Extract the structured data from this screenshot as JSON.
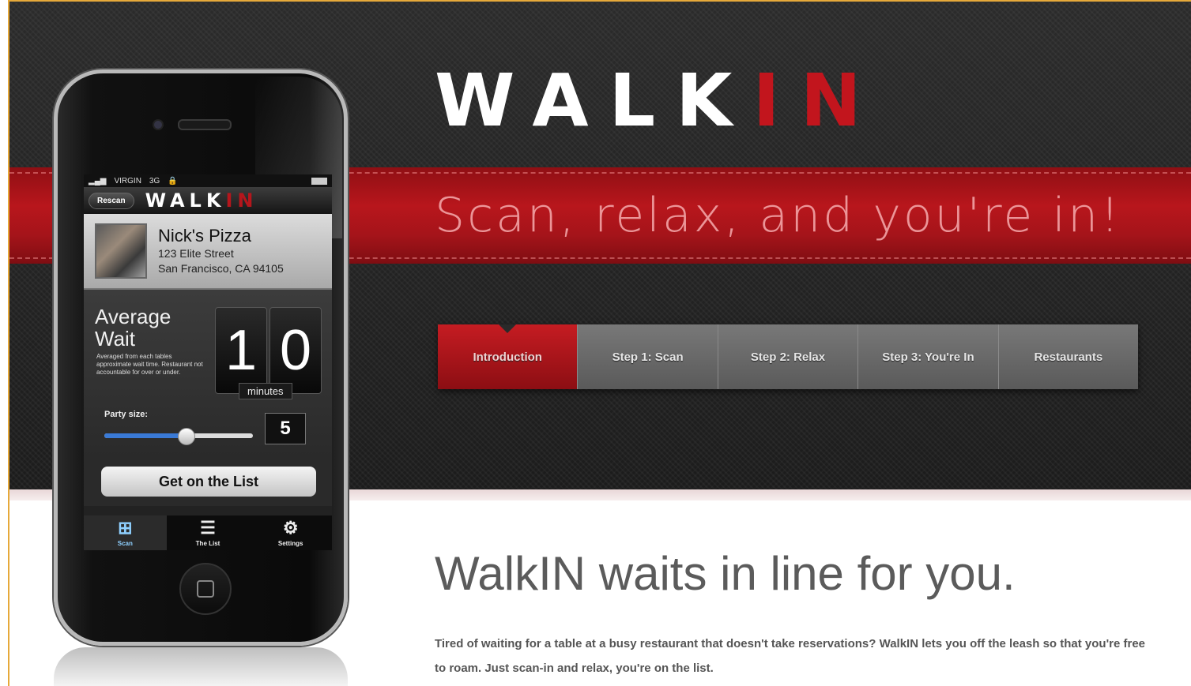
{
  "hero": {
    "logo_main": "WALK",
    "logo_accent": "IN",
    "tagline": "Scan, relax, and you're in!"
  },
  "tabs": [
    {
      "label": "Introduction",
      "active": true
    },
    {
      "label": "Step 1: Scan",
      "active": false
    },
    {
      "label": "Step 2: Relax",
      "active": false
    },
    {
      "label": "Step 3: You're In",
      "active": false
    },
    {
      "label": "Restaurants",
      "active": false
    }
  ],
  "content": {
    "headline": "WalkIN waits in line for you.",
    "description": "Tired of waiting for a table at a busy restaurant that doesn't take reservations? WalkIN lets you off the leash so that you're free to roam. Just scan-in and relax, you're on the list."
  },
  "phone": {
    "status": {
      "carrier": "VIRGIN",
      "network": "3G"
    },
    "navbar": {
      "rescan": "Rescan",
      "logo_main": "WALK",
      "logo_accent": "IN"
    },
    "restaurant": {
      "name": "Nick's Pizza",
      "address1": "123 Elite Street",
      "address2": "San Francisco, CA 94105"
    },
    "wait": {
      "title": "Average Wait",
      "note": "Averaged from each tables approximate wait time. Restaurant not accountable for over or under.",
      "digit1": "1",
      "digit2": "0",
      "unit": "minutes"
    },
    "party": {
      "label": "Party size:",
      "value": "5",
      "slider_fraction": 0.55
    },
    "cta": "Get on the List",
    "tabbar": [
      {
        "label": "Scan",
        "icon": "scan-icon"
      },
      {
        "label": "The List",
        "icon": "list-icon"
      },
      {
        "label": "Settings",
        "icon": "gear-icon"
      }
    ]
  },
  "colors": {
    "accent": "#c2151d",
    "dark": "#222222",
    "active_tab": "#b5161c"
  }
}
